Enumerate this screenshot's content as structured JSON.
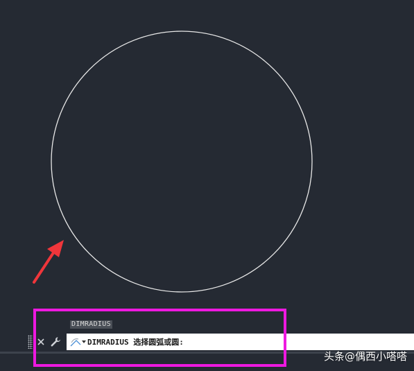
{
  "command_history": {
    "last_command": "DIMRADIUS"
  },
  "command_line": {
    "prompt": "DIMRADIUS 选择圆弧或圆:",
    "icons": {
      "grip": "grip-handle-icon",
      "close": "close-icon",
      "customize": "wrench-icon",
      "recent": "recent-commands-icon"
    }
  },
  "watermark": {
    "text": "头条@偶西小嗒嗒"
  },
  "colors": {
    "background": "#252a33",
    "circle": "#e8e8e8",
    "arrow": "#f0363b",
    "highlight": "#ee19e0",
    "command_bar": "#ffffff"
  }
}
